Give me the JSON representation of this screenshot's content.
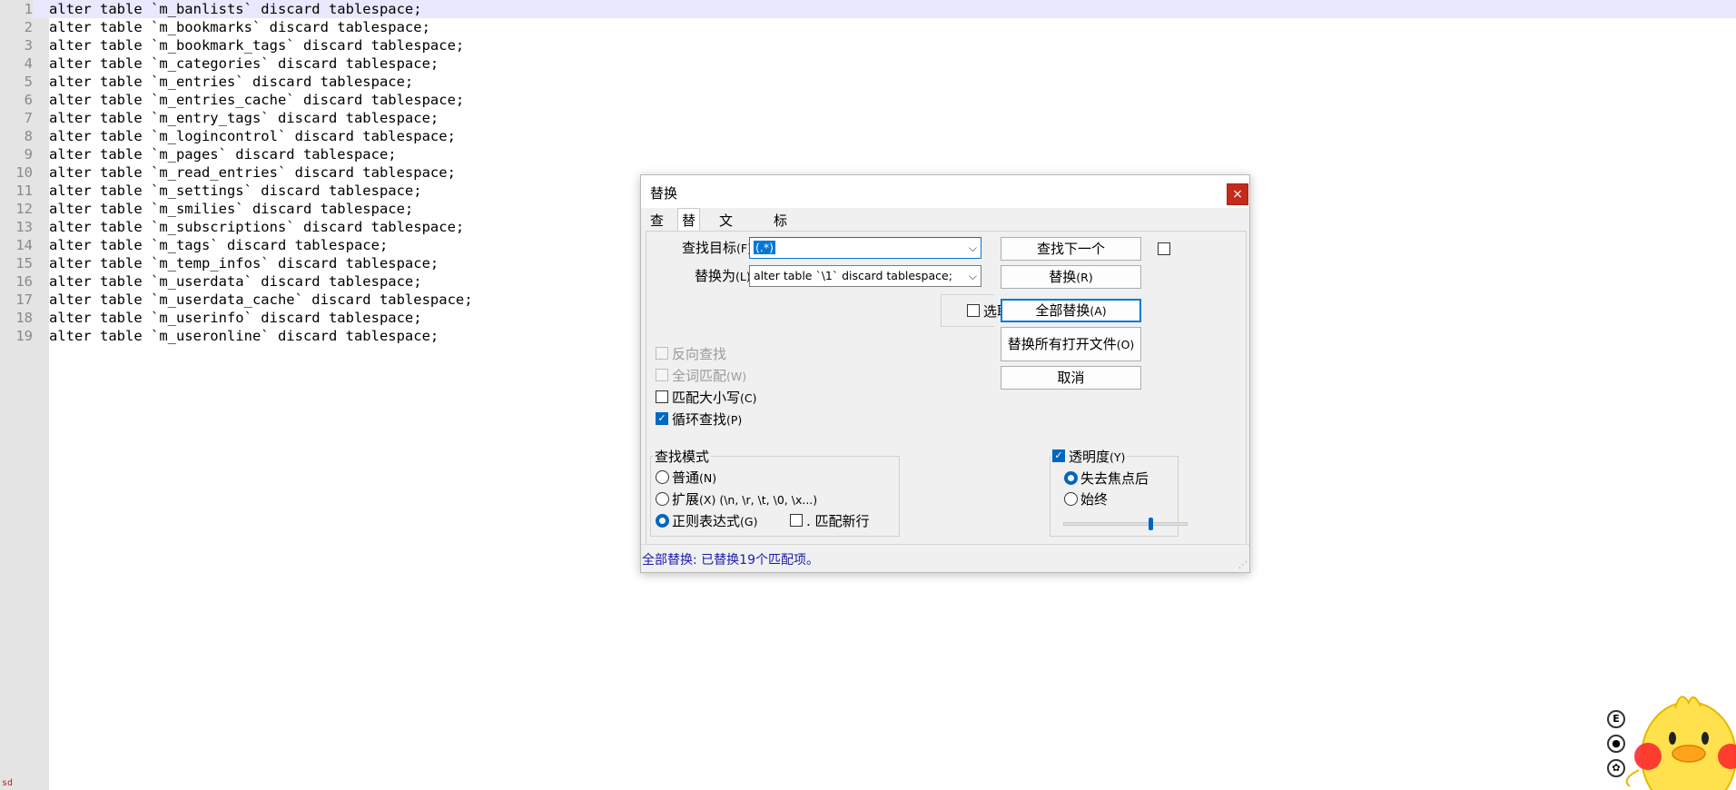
{
  "editor": {
    "lines": [
      {
        "num": "1",
        "text": "alter table `m_banlists` discard tablespace;"
      },
      {
        "num": "2",
        "text": "alter table `m_bookmarks` discard tablespace;"
      },
      {
        "num": "3",
        "text": "alter table `m_bookmark_tags` discard tablespace;"
      },
      {
        "num": "4",
        "text": "alter table `m_categories` discard tablespace;"
      },
      {
        "num": "5",
        "text": "alter table `m_entries` discard tablespace;"
      },
      {
        "num": "6",
        "text": "alter table `m_entries_cache` discard tablespace;"
      },
      {
        "num": "7",
        "text": "alter table `m_entry_tags` discard tablespace;"
      },
      {
        "num": "8",
        "text": "alter table `m_logincontrol` discard tablespace;"
      },
      {
        "num": "9",
        "text": "alter table `m_pages` discard tablespace;"
      },
      {
        "num": "10",
        "text": "alter table `m_read_entries` discard tablespace;"
      },
      {
        "num": "11",
        "text": "alter table `m_settings` discard tablespace;"
      },
      {
        "num": "12",
        "text": "alter table `m_smilies` discard tablespace;"
      },
      {
        "num": "13",
        "text": "alter table `m_subscriptions` discard tablespace;"
      },
      {
        "num": "14",
        "text": "alter table `m_tags` discard tablespace;"
      },
      {
        "num": "15",
        "text": "alter table `m_temp_infos` discard tablespace;"
      },
      {
        "num": "16",
        "text": "alter table `m_userdata` discard tablespace;"
      },
      {
        "num": "17",
        "text": "alter table `m_userdata_cache` discard tablespace;"
      },
      {
        "num": "18",
        "text": "alter table `m_userinfo` discard tablespace;"
      },
      {
        "num": "19",
        "text": "alter table `m_useronline` discard tablespace;"
      }
    ],
    "status_mark": "sd"
  },
  "dialog": {
    "title": "替换",
    "close_glyph": "×",
    "tabs": [
      {
        "label": "查找"
      },
      {
        "label": "替换"
      },
      {
        "label": "文件查找"
      },
      {
        "label": "标记"
      }
    ],
    "active_tab": "替换",
    "find": {
      "label": "查找目标",
      "shortcut": "(F)",
      "colon": " :",
      "value": "(.*)"
    },
    "replace": {
      "label": "替换为",
      "shortcut": "(L)",
      "colon": " :",
      "value": "alter table `\\1` discard tablespace;"
    },
    "buttons": {
      "find_next": "查找下一个",
      "replace": "替换",
      "replace_shortcut": "(R)",
      "replace_all": "全部替换",
      "replace_all_shortcut": "(A)",
      "replace_all_open": "替换所有打开文件",
      "replace_all_open_shortcut": "(O)",
      "cancel": "取消"
    },
    "in_selection": "选取范围内(I",
    "options": {
      "backward": "反向查找",
      "whole_word": "全词匹配",
      "whole_word_shortcut": "(W)",
      "match_case": "匹配大小写",
      "match_case_shortcut": "(C)",
      "wrap": "循环查找",
      "wrap_shortcut": "(P)"
    },
    "search_mode": {
      "title": "查找模式",
      "normal": "普通",
      "normal_shortcut": "(N)",
      "extended": "扩展",
      "extended_shortcut": "(X)",
      "extended_hint": " (\\n, \\r, \\t, \\0, \\x...)",
      "regex": "正则表达式",
      "regex_shortcut": "(G)",
      "dot_newline": ". 匹配新行"
    },
    "transparency": {
      "label": "透明度",
      "shortcut": "(Y)",
      "on_lose_focus": "失去焦点后",
      "always": "始终",
      "level_fraction": 0.7
    },
    "status": "全部替换: 已替换19个匹配项。"
  },
  "mascot": {
    "icons": [
      "E",
      "●",
      "✿"
    ]
  },
  "colors": {
    "accent": "#0067c0",
    "close": "#c42b1c",
    "status_text": "#1a1ab0",
    "current_line": "#e8e8ff"
  }
}
